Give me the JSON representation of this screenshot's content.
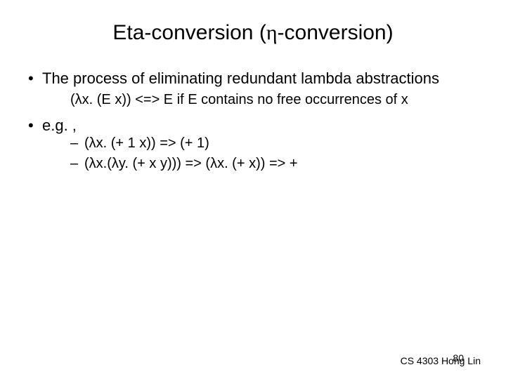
{
  "title_pre": "Eta-conversion (",
  "title_eta": "η",
  "title_post": "-conversion)",
  "bullets": {
    "b1": "The process of eliminating redundant lambda abstractions",
    "b1_sub": "(λx. (E x)) <=> E if E contains no free occurrences of x",
    "b2": "e.g. ,",
    "b2_sub1": "(λx. (+ 1 x)) => (+ 1)",
    "b2_sub2": "(λx.(λy. (+ x y))) => (λx. (+ x)) => +"
  },
  "footer": "CS 4303 Hong Lin",
  "page": "80"
}
